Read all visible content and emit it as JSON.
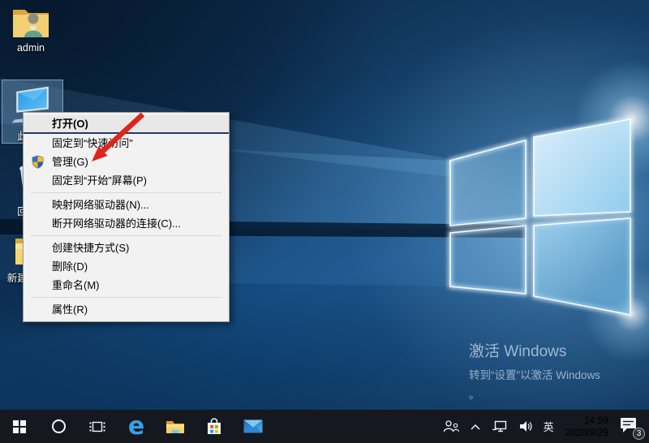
{
  "desktop": {
    "icons": {
      "admin": {
        "label": "admin",
        "icon": "user-folder-icon"
      },
      "this_pc": {
        "label": "此电脑",
        "icon": "this-pc-monitor-icon",
        "selected": true
      },
      "recycle_bin": {
        "label": "回收站",
        "icon": "recycle-bin-icon",
        "partially_hidden_by_menu": true
      },
      "new_folder": {
        "label": "新建文件夹",
        "icon": "folder-icon",
        "partially_hidden_by_menu": true
      }
    },
    "watermark": {
      "title": "激活 Windows",
      "subtitle": "转到“设置”以激活 Windows",
      "period": "。"
    }
  },
  "context_menu": {
    "items": [
      {
        "label": "打开(O)",
        "default": true
      },
      {
        "label": "固定到“快速访问”"
      },
      {
        "label": "管理(G)",
        "icon": "uac-shield-icon"
      },
      {
        "label": "固定到“开始”屏幕(P)"
      },
      {
        "label": "映射网络驱动器(N)..."
      },
      {
        "label": "断开网络驱动器的连接(C)..."
      },
      {
        "label": "创建快捷方式(S)"
      },
      {
        "label": "删除(D)"
      },
      {
        "label": "重命名(M)"
      },
      {
        "label": "属性(R)"
      }
    ]
  },
  "annotation": {
    "arrow_color": "#df241c",
    "arrow_points_to": "管理(G)"
  },
  "taskbar": {
    "buttons": [
      {
        "name": "start"
      },
      {
        "name": "cortana"
      },
      {
        "name": "task-view"
      },
      {
        "name": "edge",
        "glyph": "e"
      },
      {
        "name": "file-explorer"
      },
      {
        "name": "store"
      },
      {
        "name": "mail"
      }
    ],
    "tray": {
      "icons": [
        "people",
        "hidden-icons-chevron",
        "network",
        "volume"
      ],
      "input_language": "英",
      "time": "14:59",
      "date": "2020/9/29",
      "action_center_badge": "3"
    }
  },
  "colors": {
    "taskbar_bg": "#15181e",
    "menu_bg": "#f2f2f2",
    "menu_default_underline": "#24386e",
    "selection_highlight": "rgba(96,140,178,0.5)",
    "arrow_red": "#df241c"
  }
}
